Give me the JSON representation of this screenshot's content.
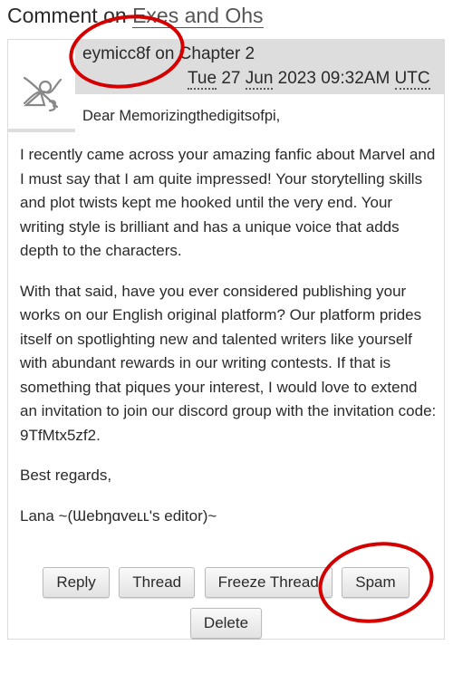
{
  "heading": {
    "prefix": "Comment on",
    "work_link": "Exes and Ohs"
  },
  "comment": {
    "author": "eymicc8f",
    "on_word": "on",
    "chapter": "Chapter 2",
    "date": {
      "weekday": "Tue",
      "day": "27",
      "month": "Jun",
      "year_time": "2023 09:32AM",
      "tz": "UTC"
    },
    "avatar_icon": "default-user-icon",
    "greeting": "Dear Memorizingthedigitsofpi,",
    "paragraphs": [
      "I recently came across your amazing fanfic about Marvel and I must say that I am quite impressed! Your storytelling skills and plot twists kept me hooked until the very end. Your writing style is brilliant and has a unique voice that adds depth to the characters.",
      "With that said, have you ever considered publishing your works on our English original platform? Our platform prides itself on spotlighting new and talented writers like yourself with abundant rewards in our writing contests. If that is something that piques your interest, I would love to extend an invitation to join our discord group with the invitation code: 9TfMtx5zf2.",
      "Best regards,",
      "Lana ~(Ɯebŋɑveʟʟ's editor)~"
    ]
  },
  "actions": {
    "reply": "Reply",
    "thread": "Thread",
    "freeze_thread": "Freeze Thread",
    "spam": "Spam",
    "delete": "Delete"
  },
  "annotation_color": "#d40000"
}
